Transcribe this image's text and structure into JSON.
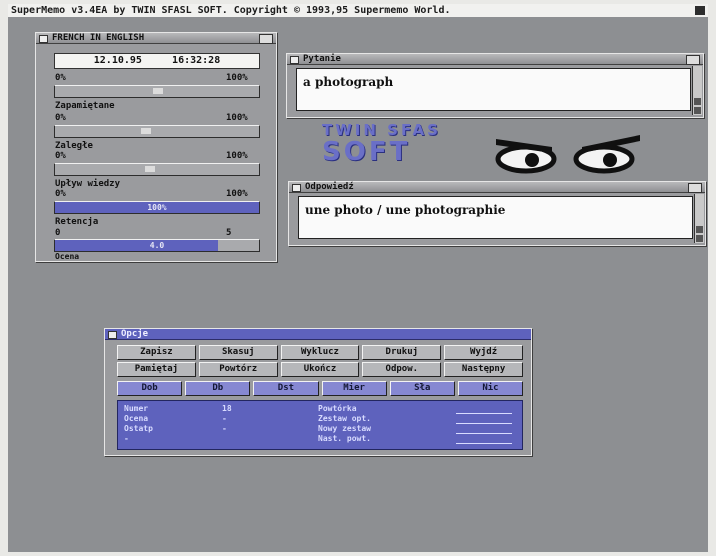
{
  "screen_title": "SuperMemo v3.4EA by TWIN SFASL SOFT.  Copyright © 1993,95 Supermemo World.",
  "stats_window": {
    "title": "FRENCH IN ENGLISH",
    "date": "12.10.95",
    "time": "16:32:28",
    "rows": [
      {
        "label": "",
        "left": "0%",
        "right": "100%",
        "progress": 0.52
      },
      {
        "label": "Zapamiętane",
        "left": "0%",
        "right": "100%",
        "progress": 0.45
      },
      {
        "label": "Zaległe",
        "left": "0%",
        "right": "100%",
        "progress": 0.46
      },
      {
        "label": "Upływ wiedzy",
        "left": "0%",
        "right": "100%",
        "progress": 1.0,
        "value": "100%"
      },
      {
        "label": "Retencja",
        "left": "0",
        "right": "5",
        "progress": 0.8,
        "value": "4.0"
      }
    ],
    "bottom_label": "Ocena"
  },
  "question_window": {
    "title": "Pytanie",
    "text": "a photograph"
  },
  "answer_window": {
    "title": "Odpowiedź",
    "text": "une photo / une photographie"
  },
  "logo": {
    "line1": "TWIN SFAS",
    "line2": "SOFT"
  },
  "control_window": {
    "title": "Opcje",
    "row1": [
      "Zapisz",
      "Skasuj",
      "Wyklucz",
      "Drukuj",
      "Wyjdź"
    ],
    "row2": [
      "Pamiętaj",
      "Powtórz",
      "Ukończ",
      "Odpow.",
      "Następny"
    ],
    "row3": [
      "Dob",
      "Db",
      "Dst",
      "Mier",
      "Sła",
      "Nic"
    ],
    "info_left": [
      {
        "label": "Numer",
        "value": "18"
      },
      {
        "label": "Ocena",
        "value": "-"
      },
      {
        "label": "Ostatp",
        "value": "-"
      },
      {
        "label": "-",
        "value": ""
      }
    ],
    "info_right": [
      "Powtórka",
      "Zestaw opt.",
      "Nowy zestaw",
      "Nast. powt."
    ]
  },
  "colors": {
    "accent": "#5e62bd",
    "background": "#8d8f92"
  }
}
